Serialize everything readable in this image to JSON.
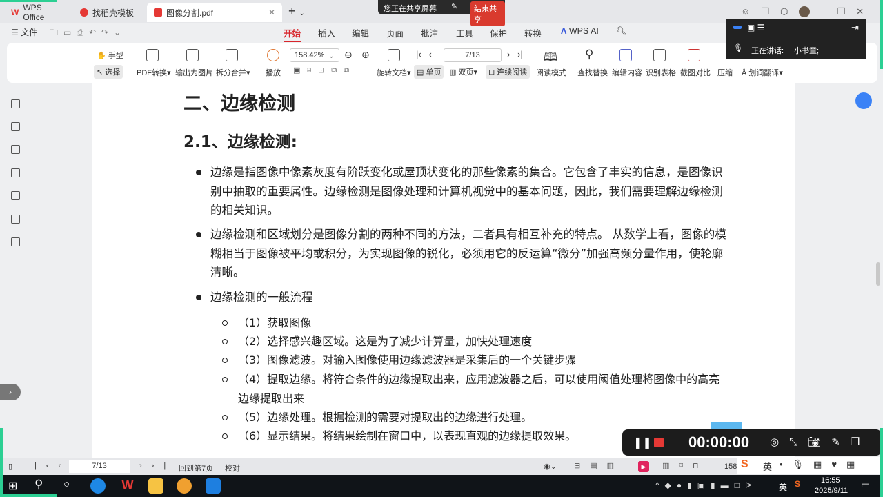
{
  "tabs": [
    {
      "label": "WPS Office"
    },
    {
      "label": "找稻壳模板"
    },
    {
      "label": "图像分割.pdf"
    }
  ],
  "share": {
    "status": "您正在共享屏幕",
    "stop": "结束共享"
  },
  "menu": {
    "file": "文件",
    "items": [
      "开始",
      "插入",
      "编辑",
      "页面",
      "批注",
      "工具",
      "保护",
      "转换"
    ],
    "ai": "WPS AI"
  },
  "toolbar": {
    "hand": "手型",
    "select": "选择",
    "pdf_convert": "PDF转换",
    "export_image": "输出为图片",
    "split_merge": "拆分合并",
    "play": "播放",
    "zoom": "158.42%",
    "rotate": "旋转文档",
    "single": "单页",
    "double": "双页",
    "continuous": "连续阅读",
    "read_mode": "阅读模式",
    "page": "7/13",
    "find": "查找替换",
    "edit": "编辑内容",
    "table": "识别表格",
    "compare": "截图对比",
    "compress": "压缩",
    "translate": "划词翻译"
  },
  "speaker": {
    "label": "正在讲话:",
    "name": "小书童;"
  },
  "doc": {
    "h1": "二、边缘检测",
    "h2": "2.1、边缘检测:",
    "paras": [
      "边缘是指图像中像素灰度有阶跃变化或屋顶状变化的那些像素的集合。它包含了丰实的信息，是图像识别中抽取的重要属性。边缘检测是图像处理和计算机视觉中的基本问题，因此，我们需要理解边缘检测的相关知识。",
      "边缘检测和区域划分是图像分割的两种不同的方法，二者具有相互补充的特点。 从数学上看，图像的模糊相当于图像被平均或积分，为实现图像的锐化，必须用它的反运算“微分”加强高频分量作用，使轮廓清晰。",
      "边缘检测的一般流程"
    ],
    "steps": [
      "（1）获取图像",
      "（2）选择感兴趣区域。这是为了减少计算量，加快处理速度",
      "（3）图像滤波。对输入图像使用边缘滤波器是采集后的一个关键步骤",
      "（4）提取边缘。将符合条件的边缘提取出来，应用滤波器之后，可以使用阈值处理将图像中的高亮边缘提取出来",
      "（5）边缘处理。根据检测的需要对提取出的边缘进行处理。",
      "（6）显示结果。将结果绘制在窗口中，以表现直观的边缘提取效果。"
    ]
  },
  "status": {
    "page": "7/13",
    "back": "回到第7页",
    "proof": "校对",
    "zoom": "158"
  },
  "recorder": {
    "time": "00:00:00"
  },
  "ime": {
    "lang": "英"
  },
  "clock": {
    "time": "16:55",
    "date": "2025/9/11",
    "lang": "英"
  }
}
